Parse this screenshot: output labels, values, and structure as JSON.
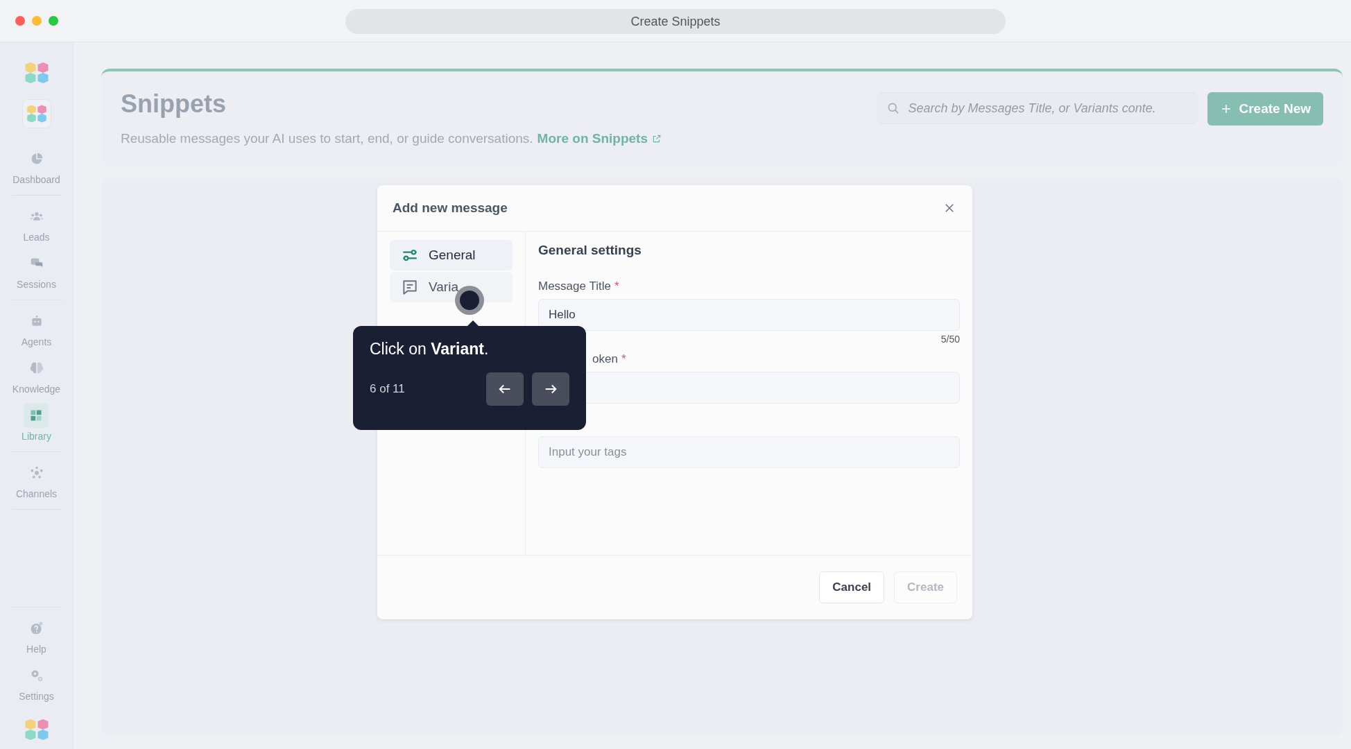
{
  "window": {
    "title": "Create Snippets"
  },
  "sidebar": {
    "groups": [
      {
        "items": [
          {
            "label": "Dashboard",
            "selected": false
          }
        ]
      },
      {
        "items": [
          {
            "label": "Leads",
            "selected": false
          },
          {
            "label": "Sessions",
            "selected": false
          }
        ]
      },
      {
        "items": [
          {
            "label": "Agents",
            "selected": false
          },
          {
            "label": "Knowledge",
            "selected": false
          },
          {
            "label": "Library",
            "selected": true
          }
        ]
      },
      {
        "items": [
          {
            "label": "Channels",
            "selected": false
          }
        ]
      }
    ],
    "bottom": [
      {
        "label": "Help",
        "selected": false
      },
      {
        "label": "Settings",
        "selected": false
      }
    ]
  },
  "header": {
    "title": "Snippets",
    "description": "Reusable messages your AI uses to start, end, or guide conversations.",
    "link": "More on Snippets",
    "search": {
      "placeholder": "Search by Messages Title, or Variants conte."
    },
    "create_button": "Create New"
  },
  "dialog": {
    "title": "Add new message",
    "tabs": [
      {
        "label": "General",
        "selected": true
      },
      {
        "label": "Varia",
        "selected": false
      }
    ],
    "section_title": "General settings",
    "fields": [
      {
        "label": "Message Title",
        "required_mark": "*",
        "value": "Hello",
        "counter": "5/50"
      },
      {
        "label": "oken",
        "required_mark": "*"
      },
      {
        "placeholder": "Input your tags"
      }
    ],
    "buttons": [
      {
        "label": "Cancel",
        "disabled": false
      },
      {
        "label": "Create",
        "disabled": true
      }
    ]
  },
  "tour": {
    "text": "Click on **Variant**.",
    "step": "6 of 11"
  }
}
